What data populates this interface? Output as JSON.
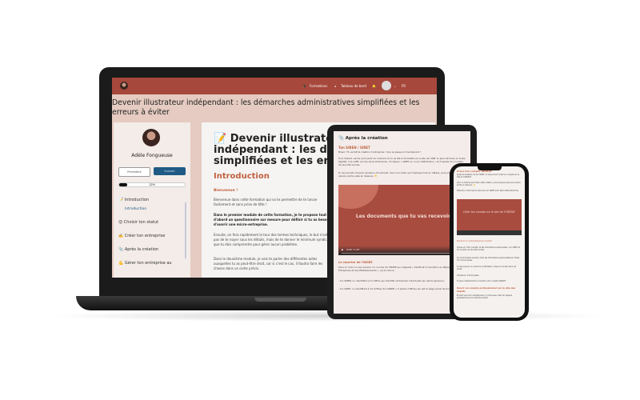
{
  "laptop": {
    "nav": {
      "formations": "Formations",
      "dashboard": "Tableau de bord",
      "lang": "FR"
    },
    "course_title": "Devenir illustrateur indépendant : les démarches administratives simplifiées et les erreurs à éviter",
    "sidebar": {
      "user_name": "Adèle Fongueuse",
      "prev_label": "Précédent",
      "next_label": "Suivant",
      "progress_percent": 12,
      "progress_label": "12%",
      "modules": [
        {
          "label": "📝 Introduction",
          "sub": "Introduction"
        },
        {
          "label": "😊 Choisir ton statut"
        },
        {
          "label": "✍️ Créer ton entreprise"
        },
        {
          "label": "📎 Après la création"
        },
        {
          "label": "💪 Gérer ton entreprise au"
        }
      ]
    },
    "main": {
      "heading": "📝 Devenir illustrateur indépendant : les démarches simplifiées et les erreurs à éviter",
      "section": "Introduction",
      "welcome": "Bienvenue !",
      "p1": "Bienvenue dans cette formation qui va te permettre de te lancer facilement et sans prise de tête !",
      "p2": "Dans le premier module de cette formation, je te propose tout d'abord un questionnaire sur mesure pour définir si tu as besoin d'ouvrir une micro-entreprise.",
      "p3": "Ensuite, on fera rapidement le tour des termes techniques, le but n'est pas de te noyer sous les détails, mais de te donner le minimum syndical que tu dois comprendre pour gérer aucun problème.",
      "p4": "Dans le deuxième module, je vais te parler des différentes aides auxquelles tu as peut-être droit, car si c'est le cas, il faudra faire les choses dans un ordre précis."
    }
  },
  "tablet": {
    "heading": "📎 Après la création",
    "sub1": "Ton SIREN / SIRET",
    "p1": "Bravo ! Tu as fait ta création d'entreprise ! Que se passe-t-il maintenant ?",
    "p2": "Tout d'abord, sache qu'à partir du moment où tu as fait la formalité sur le site de l'INPI, tu peux facturer en toute légalité. Il te suffit, sur tes devis et factures, d'indiquer « SIRET en cours d'attribution » et d'ajouter ton numéro de sécurité sociale.",
    "p3": "Tu vas ensuite recevoir plusieurs documents. Voici une vidéo qui t'explique tout en détails, je te propose aussi la version écrite juste en dessous. 👇",
    "video_title": "Les documents que tu vas recevoir",
    "video_time": "0:00 / 1:07",
    "sub2": "Le courrier de l'INSEE",
    "p4": "Sous un mois, tu vas recevoir un courrier de l'INSEE qui s'appelle « Certificat d'inscription au Répertoire des Entreprises et des Établissements », qui te donne :",
    "p5": "- ton SIREN, un identifiant à 9 chiffres qui identifie l'entreprise individuelle qui est ta personne.",
    "p6": "- ton SIRET, un identifiant à 14 chiffres (ton SIREN + 5 autres chiffres) qui est le siège social de ton entreprise."
  },
  "phone": {
    "heading": "Créer ton compte URSSAF",
    "p1": "Après la réception de ton SIRET, tu vas pouvoir créer ton compte sur le site de l'URSSAF.",
    "p2": "Voici un tutoriel pour faire cette création, je te propose aussi une version écrite en dessous. 👇",
    "p3": "Attention, il faut que tu aies reçu ton SIRET pour faire cette démarche.",
    "video_title": "Créer ton compte sur le site de l'URSSAF",
    "link": "Rends-toi sur autoentrepreneur.urssaf.fr",
    "p4": "Clique sur \"Mon compte\" et tes informations personnelles : ton SIRET et ton numéro de sécurité sociale.",
    "p5": "Sur le formulaire suivant, entre tes informations personnelles et choisis ton mot de passe.",
    "p6": "Tu vas recevoir un email de confirmation, clique sur le lien dans cet email.",
    "p7": "Choisis ton mot de passe.",
    "p8": "Tu peux maintenant te connecter à ton compte URSSAF.",
    "sub2": "Ouvrir un compte professionnel sur le site des impôts",
    "p9": "En tant que micro-entrepreneur, tu dois aussi créer ton espace professionnel sur le site des impôts."
  },
  "colors": {
    "brand": "#a6483b",
    "accent_text": "#c0613f",
    "button_blue": "#1f5a85",
    "page_bg": "#e5cbc1"
  }
}
